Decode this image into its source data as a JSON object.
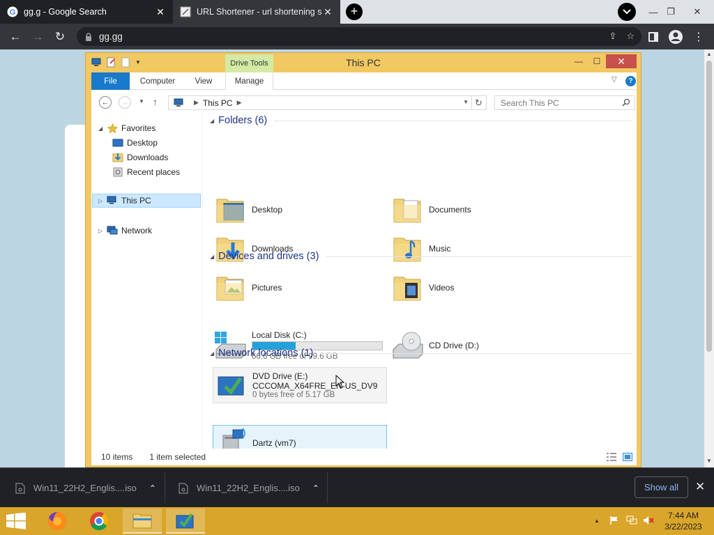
{
  "browser": {
    "tabs": [
      {
        "title": "gg.g - Google Search",
        "active": true
      },
      {
        "title": "URL Shortener - url shortening se",
        "active": false
      }
    ],
    "address": "gg.gg"
  },
  "explorer": {
    "title": "This PC",
    "context_tab": "Drive Tools",
    "ribbon_tabs": [
      "File",
      "Computer",
      "View",
      "Manage"
    ],
    "breadcrumb": "This PC",
    "search_placeholder": "Search This PC",
    "nav": {
      "favorites": "Favorites",
      "desktop": "Desktop",
      "downloads": "Downloads",
      "recent": "Recent places",
      "this_pc": "This PC",
      "network": "Network"
    },
    "groups": {
      "folders": "Folders (6)",
      "devices": "Devices and drives (3)",
      "network": "Network locations (1)"
    },
    "folders": [
      "Desktop",
      "Documents",
      "Downloads",
      "Music",
      "Pictures",
      "Videos"
    ],
    "drives": {
      "c_name": "Local Disk (C:)",
      "c_free": "66.6 GB free of 99.6 GB",
      "c_used_fraction": 0.331,
      "d_name": "CD Drive (D:)",
      "e_name": "DVD Drive (E:)",
      "e_label": "CCCOMA_X64FRE_EN-US_DV9",
      "e_free": "0 bytes free of 5.17 GB"
    },
    "network_location": "Dartz (vm7)",
    "status": {
      "items": "10 items",
      "selected": "1 item selected"
    }
  },
  "downloads": {
    "items": [
      "Win11_22H2_Englis....iso",
      "Win11_22H2_Englis....iso"
    ],
    "show_all": "Show all"
  },
  "taskbar": {
    "time": "7:44 AM",
    "date": "3/22/2023"
  },
  "colors": {
    "explorer_frame": "#f1c862",
    "taskbar": "#d9a52a",
    "file_tab": "#1979ca",
    "group_header": "#1e3287"
  }
}
